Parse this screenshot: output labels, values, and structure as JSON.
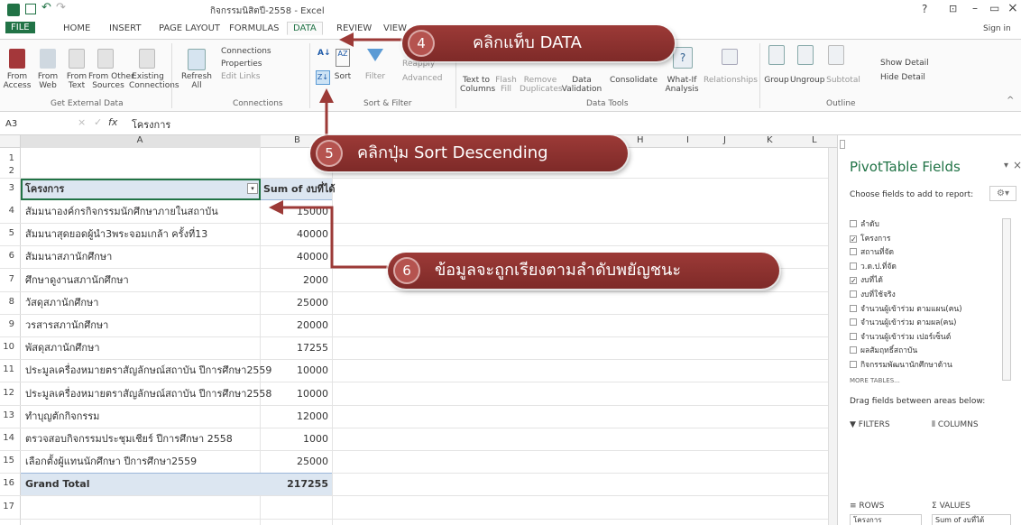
{
  "title_bar": {
    "title": "กิจกรรมนิสิตปี-2558 - Excel",
    "help": "?",
    "min": "–",
    "restore": "▭",
    "close": "×",
    "sign_in": "Sign in"
  },
  "tabs": [
    "FILE",
    "HOME",
    "INSERT",
    "PAGE LAYOUT",
    "FORMULAS",
    "DATA",
    "REVIEW",
    "VIEW"
  ],
  "active_tab": "DATA",
  "ribbon": {
    "from_access": "From\nAccess",
    "from_web": "From\nWeb",
    "from_text": "From\nText",
    "from_other": "From Other\nSources",
    "existing": "Existing\nConnections",
    "group_external": "Get External Data",
    "refresh": "Refresh\nAll",
    "connections": "Connections",
    "properties": "Properties",
    "edit_links": "Edit Links",
    "group_connections": "Connections",
    "sort": "Sort",
    "filter": "Filter",
    "reapply": "Reapply",
    "advanced": "Advanced",
    "group_sort": "Sort & Filter",
    "text_to_columns": "Text to\nColumns",
    "flash_fill": "Flash\nFill",
    "remove_dup": "Remove\nDuplicates",
    "data_validation": "Data\nValidation",
    "consolidate": "Consolidate",
    "what_if": "What-If\nAnalysis",
    "relationships": "Relationships",
    "group_tools": "Data Tools",
    "group": "Group",
    "ungroup": "Ungroup",
    "subtotal": "Subtotal",
    "show_detail": "Show Detail",
    "hide_detail": "Hide Detail",
    "group_outline": "Outline"
  },
  "formula_bar": {
    "name_box": "A3",
    "fx": "fx",
    "value": "โครงการ"
  },
  "columns": [
    "A",
    "B",
    "H",
    "I",
    "J",
    "K",
    "L"
  ],
  "rows": [
    {
      "n": "1",
      "a": "",
      "b": ""
    },
    {
      "n": "2",
      "a": "",
      "b": ""
    },
    {
      "n": "3",
      "a": "โครงการ",
      "b": "Sum of งบที่ได้"
    },
    {
      "n": "4",
      "a": "สัมมนาองค์กรกิจกรรมนักศึกษาภายในสถาบัน",
      "b": "15000"
    },
    {
      "n": "5",
      "a": "สัมมนาสุดยอดผู้นำ3พระจอมเกล้า ครั้งที่13",
      "b": "40000"
    },
    {
      "n": "6",
      "a": "สัมมนาสภานักศึกษา",
      "b": "40000"
    },
    {
      "n": "7",
      "a": "ศึกษาดูงานสภานักศึกษา",
      "b": "2000"
    },
    {
      "n": "8",
      "a": "วัสดุสภานักศึกษา",
      "b": "25000"
    },
    {
      "n": "9",
      "a": "วรสารสภานักศึกษา",
      "b": "20000"
    },
    {
      "n": "10",
      "a": "พัสดุสภานักศึกษา",
      "b": "17255"
    },
    {
      "n": "11",
      "a": "ประมูลเครื่องหมายตราสัญลักษณ์สถาบัน ปีการศึกษา2559",
      "b": "10000"
    },
    {
      "n": "12",
      "a": "ประมูลเครื่องหมายตราสัญลักษณ์สถาบัน ปีการศึกษา2558",
      "b": "10000"
    },
    {
      "n": "13",
      "a": "ทำบุญตักกิจกรรม",
      "b": "12000"
    },
    {
      "n": "14",
      "a": "ตรวจสอบกิจกรรมประชุมเชียร์ ปีการศึกษา 2558",
      "b": "1000"
    },
    {
      "n": "15",
      "a": "เลือกตั้งผู้แทนนักศึกษา ปีการศึกษา2559",
      "b": "25000"
    },
    {
      "n": "16",
      "a": "Grand Total",
      "b": "217255"
    },
    {
      "n": "17",
      "a": "",
      "b": ""
    }
  ],
  "pivot_pane": {
    "title": "PivotTable Fields",
    "choose": "Choose fields to add to report:",
    "fields": [
      {
        "label": "ลำดับ",
        "checked": false
      },
      {
        "label": "โครงการ",
        "checked": true
      },
      {
        "label": "สถานที่จัด",
        "checked": false
      },
      {
        "label": "ว.ด.ป.ที่จัด",
        "checked": false
      },
      {
        "label": "งบที่ได้",
        "checked": true
      },
      {
        "label": "งบที่ใช้จริง",
        "checked": false
      },
      {
        "label": "จำนวนผู้เข้าร่วม ตามแผน(คน)",
        "checked": false
      },
      {
        "label": "จำนวนผู้เข้าร่วม ตามผล(คน)",
        "checked": false
      },
      {
        "label": "จำนวนผู้เข้าร่วม เปอร์เซ็นต์",
        "checked": false
      },
      {
        "label": "ผลสัมฤทธิ์สถาบัน",
        "checked": false
      },
      {
        "label": "กิจกรรมพัฒนานักศึกษาด้าน",
        "checked": false
      }
    ],
    "more_tables": "MORE TABLES...",
    "drag": "Drag fields between areas below:",
    "filters": "FILTERS",
    "columns": "COLUMNS",
    "rows": "ROWS",
    "values": "VALUES",
    "row_item": "โครงการ",
    "value_item": "Sum of งบที่ได้"
  },
  "callouts": [
    {
      "num": "4",
      "text": "คลิกแท็บ DATA"
    },
    {
      "num": "5",
      "text": "คลิกปุ่ม Sort Descending"
    },
    {
      "num": "6",
      "text": "ข้อมูลจะถูกเรียงตามลำดับพยัญชนะ"
    }
  ],
  "colors": {
    "excel_green": "#217346",
    "callout": "#8e3330",
    "pivot_header": "#dce6f1",
    "total_row": "#dce6f1"
  }
}
